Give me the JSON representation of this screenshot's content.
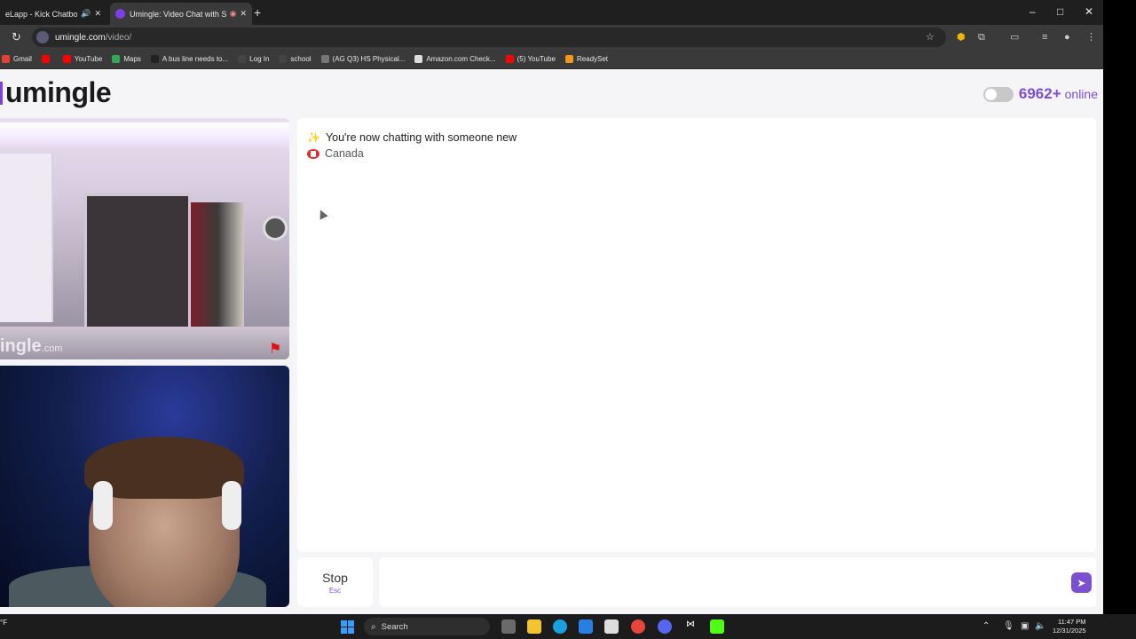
{
  "browser": {
    "tabs": [
      {
        "title": "eLapp - Kick Chatbot a",
        "active": false
      },
      {
        "title": "Umingle: Video Chat with S",
        "active": true
      }
    ],
    "new_tab_symbol": "+",
    "window_controls": {
      "minimize": "–",
      "maximize": "□",
      "close": "✕"
    },
    "reload_symbol": "↻",
    "url_host": "umingle.com",
    "url_path": "/video/",
    "bookmarks": [
      {
        "label": "Gmail",
        "icon": "gmail-icon",
        "color": "#e44133"
      },
      {
        "label": "",
        "icon": "youtube-icon",
        "color": "#ff0000"
      },
      {
        "label": "YouTube",
        "icon": "youtube-icon",
        "color": "#ff0000"
      },
      {
        "label": "Maps",
        "icon": "maps-icon",
        "color": "#34a853"
      },
      {
        "label": "A bus line needs to...",
        "icon": "page-icon",
        "color": "#222222"
      },
      {
        "label": "Log In",
        "icon": "canvas-icon",
        "color": "#444444"
      },
      {
        "label": "school",
        "icon": "folder-icon",
        "color": "#444444"
      },
      {
        "label": "(AG Q3) HS Physical...",
        "icon": "globe-icon",
        "color": "#777777"
      },
      {
        "label": "Amazon.com Check...",
        "icon": "amazon-icon",
        "color": "#dddddd"
      },
      {
        "label": "(5) YouTube",
        "icon": "youtube-icon",
        "color": "#ff0000"
      },
      {
        "label": "ReadySet",
        "icon": "readyset-icon",
        "color": "#f09a1a"
      }
    ]
  },
  "page": {
    "logo": "umingle",
    "online_count": "6962+",
    "online_label": "online",
    "watermark_main": "ingle",
    "watermark_suffix": ".com",
    "chat": {
      "status_message": "You're now chatting with someone new",
      "country": "Canada"
    },
    "stop_label": "Stop",
    "stop_shortcut": "Esc",
    "message_placeholder": "",
    "send_symbol": "➤",
    "accent_color": "#7b4fd0"
  },
  "taskbar": {
    "weather": "°F",
    "search_label": "Search",
    "time": "11:47 PM",
    "date": "12/31/2025"
  }
}
